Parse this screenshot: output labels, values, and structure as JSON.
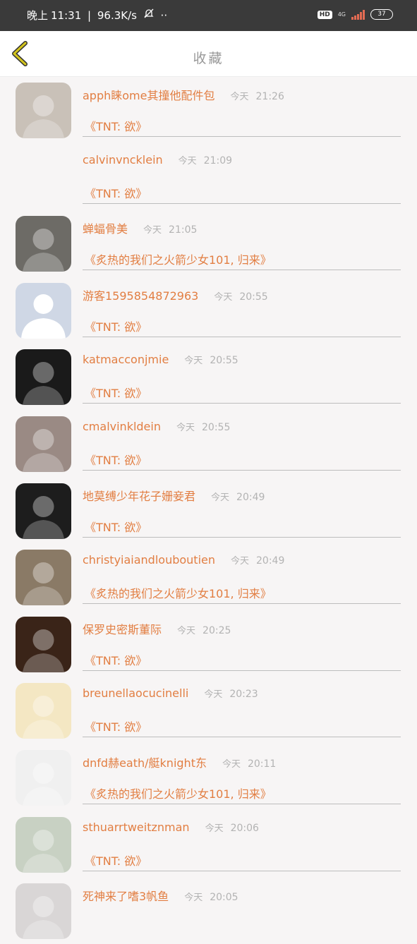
{
  "status_bar": {
    "time_prefix": "晚上",
    "time": "11:31",
    "speed": "96.3K/s",
    "dots": "··",
    "hd": "HD",
    "network": "4G",
    "battery": "37"
  },
  "header": {
    "title": "收藏"
  },
  "colors": {
    "accent": "#e27e42",
    "back_arrow": "#d4c51d"
  },
  "list": [
    {
      "name": "apph睐ome其撞他配件包",
      "time_label": "今天",
      "time": "21:26",
      "message": "《TNT: 欲》",
      "avatar": "avatar-child",
      "avatar_color": "#c9c1b8"
    },
    {
      "name": "calvinvncklein",
      "time_label": "今天",
      "time": "21:09",
      "message": "《TNT: 欲》",
      "avatar": "none",
      "avatar_color": ""
    },
    {
      "name": "蝉蝠骨美",
      "time_label": "今天",
      "time": "21:05",
      "message": "《炙热的我们之火箭少女101, 归来》",
      "avatar": "avatar-man",
      "avatar_color": "#6d6b66"
    },
    {
      "name": "游客1595854872963",
      "time_label": "今天",
      "time": "20:55",
      "message": "《TNT: 欲》",
      "avatar": "avatar-default",
      "avatar_color": "#cfd7e5"
    },
    {
      "name": "katmacconjmie",
      "time_label": "今天",
      "time": "20:55",
      "message": "《TNT: 欲》",
      "avatar": "avatar-kitty",
      "avatar_color": "#1a1a1a"
    },
    {
      "name": "cmalvinkldein",
      "time_label": "今天",
      "time": "20:55",
      "message": "《TNT: 欲》",
      "avatar": "avatar-couple",
      "avatar_color": "#9a8a84"
    },
    {
      "name": "地莫缚少年花子姗妾君",
      "time_label": "今天",
      "time": "20:49",
      "message": "《TNT: 欲》",
      "avatar": "avatar-ghost",
      "avatar_color": "#1d1d1d"
    },
    {
      "name": "christyiaiandlouboutien",
      "time_label": "今天",
      "time": "20:49",
      "message": "《炙热的我们之火箭少女101, 归来》",
      "avatar": "avatar-rooster",
      "avatar_color": "#8a7a66"
    },
    {
      "name": "保罗史密斯董际",
      "time_label": "今天",
      "time": "20:25",
      "message": "《TNT: 欲》",
      "avatar": "avatar-dark",
      "avatar_color": "#3a2418"
    },
    {
      "name": "breunellaocucinelli",
      "time_label": "今天",
      "time": "20:23",
      "message": "《TNT: 欲》",
      "avatar": "avatar-girl-rose",
      "avatar_color": "#f4e7c3"
    },
    {
      "name": "dnfd赫eath/艇knight东",
      "time_label": "今天",
      "time": "20:11",
      "message": "《炙热的我们之火箭少女101, 归来》",
      "avatar": "avatar-tiger",
      "avatar_color": "#f0f0f0"
    },
    {
      "name": "sthuarrtweitznman",
      "time_label": "今天",
      "time": "20:06",
      "message": "《TNT: 欲》",
      "avatar": "avatar-girl",
      "avatar_color": "#c8d1c3"
    },
    {
      "name": "死神来了嗜3帆鱼",
      "time_label": "今天",
      "time": "20:05",
      "message": "",
      "avatar": "avatar-girl2",
      "avatar_color": "#d9d6d6"
    }
  ]
}
